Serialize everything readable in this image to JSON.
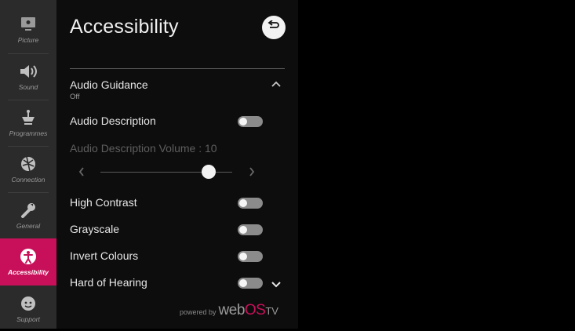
{
  "sidebar": {
    "items": [
      {
        "label": "Picture",
        "icon": "picture-icon"
      },
      {
        "label": "Sound",
        "icon": "sound-icon"
      },
      {
        "label": "Programmes",
        "icon": "antenna-icon"
      },
      {
        "label": "Connection",
        "icon": "globe-icon"
      },
      {
        "label": "General",
        "icon": "wrench-icon"
      },
      {
        "label": "Accessibility",
        "icon": "accessibility-icon",
        "active": true
      },
      {
        "label": "Support",
        "icon": "support-icon"
      }
    ]
  },
  "header": {
    "title": "Accessibility",
    "back_icon": "back-icon"
  },
  "menu": {
    "audio_guidance": {
      "label": "Audio Guidance",
      "value": "Off",
      "expanded": true
    },
    "audio_description": {
      "label": "Audio Description",
      "on": false
    },
    "audio_description_volume": {
      "label": "Audio Description Volume : 10",
      "value": 10,
      "min": 0,
      "max": 100,
      "enabled": false
    },
    "high_contrast": {
      "label": "High Contrast",
      "on": false
    },
    "grayscale": {
      "label": "Grayscale",
      "on": false
    },
    "invert_colours": {
      "label": "Invert Colours",
      "on": false
    },
    "hard_of_hearing": {
      "label": "Hard of Hearing",
      "on": false
    }
  },
  "footer": {
    "powered_by": "powered by",
    "brand_web": "web",
    "brand_os": "OS",
    "brand_tv": "TV"
  },
  "colors": {
    "accent": "#c8105a",
    "sidebar": "#2b2b2b",
    "panel": "#0d0d0d"
  }
}
